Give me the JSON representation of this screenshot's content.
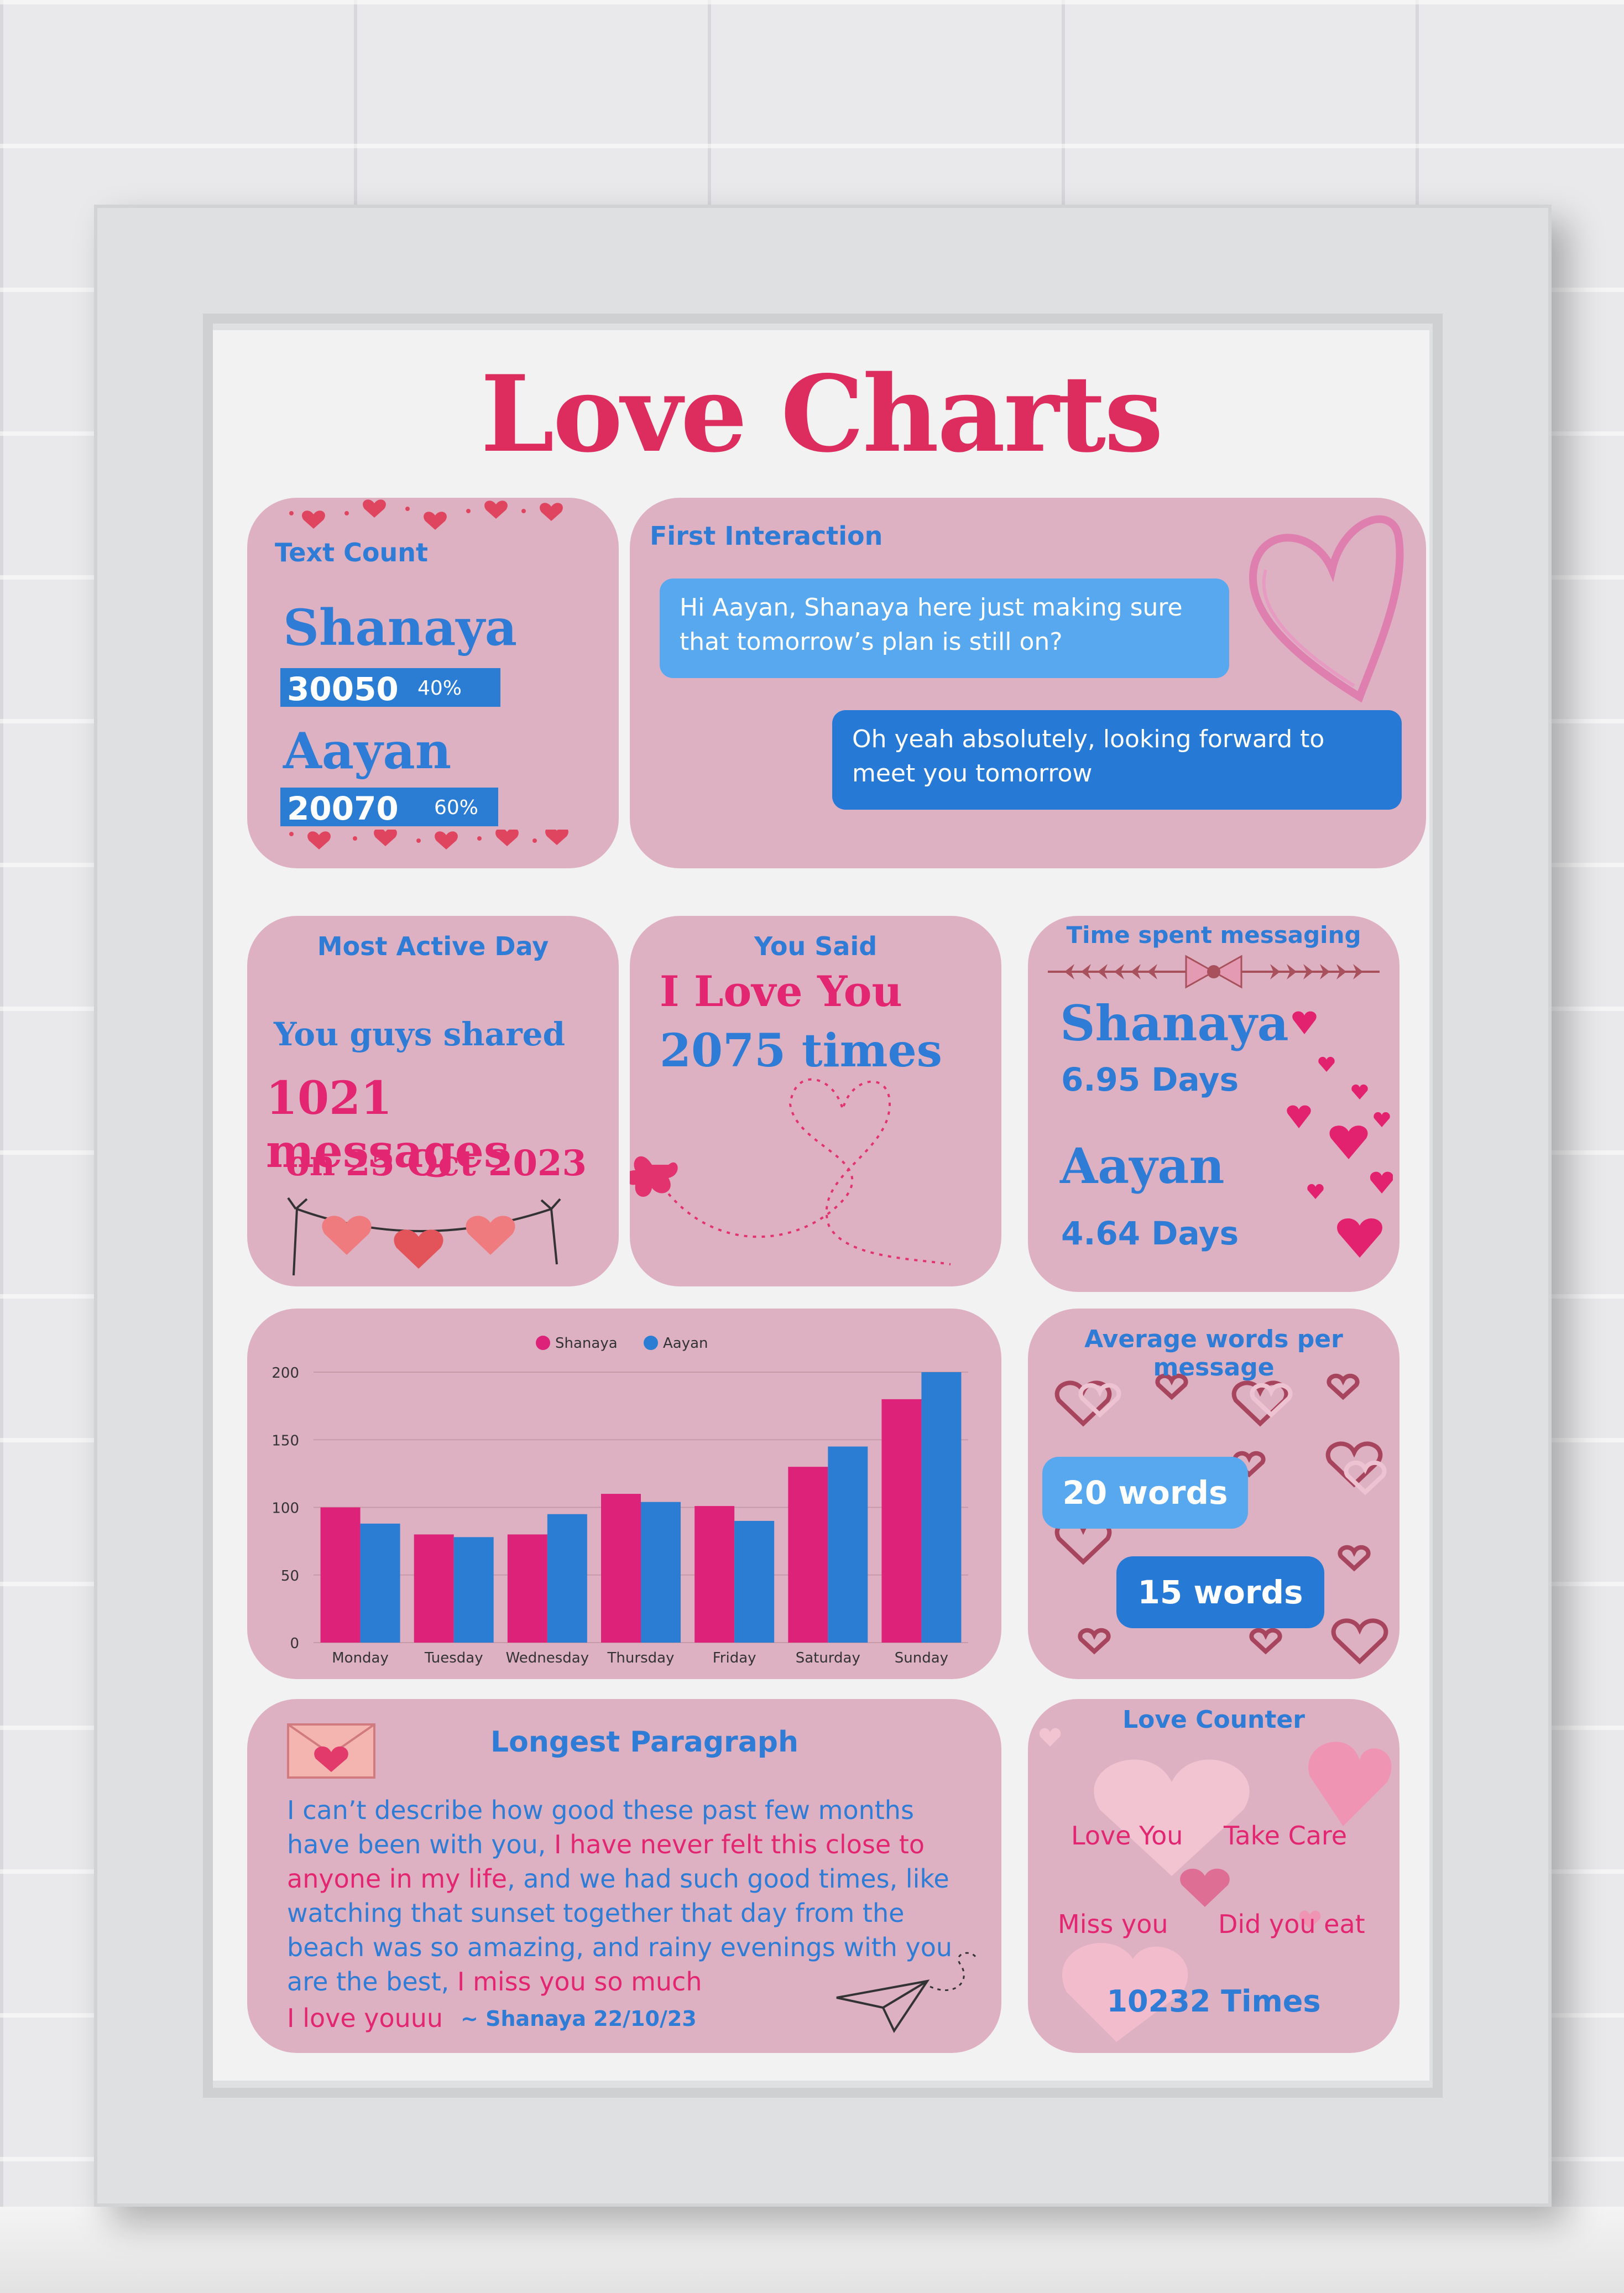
{
  "title": "Love Charts",
  "text_count": {
    "label": "Text Count",
    "people": [
      {
        "name": "Shanaya",
        "count": "30050",
        "pct": "40%"
      },
      {
        "name": "Aayan",
        "count": "20070",
        "pct": "60%"
      }
    ]
  },
  "first_interaction": {
    "label": "First Interaction",
    "msg1": "Hi Aayan, Shanaya here just making sure that tomorrow’s plan is still on?",
    "msg2": "Oh yeah absolutely, looking forward to meet you tomorrow"
  },
  "most_active_day": {
    "label": "Most Active Day",
    "line1": "You guys shared",
    "line2": "1021 messages",
    "on": "on",
    "date": "25 Oct 2023"
  },
  "you_said": {
    "label": "You Said",
    "phrase": "I Love You",
    "times": "2075 times"
  },
  "time_spent": {
    "label": "Time spent messaging",
    "people": [
      {
        "name": "Shanaya",
        "value": "6.95 Days"
      },
      {
        "name": "Aayan",
        "value": "4.64 Days"
      }
    ]
  },
  "avg_words": {
    "label": "Average words per message",
    "first": "20 words",
    "second": "15 words"
  },
  "longest_paragraph": {
    "label": "Longest Paragraph",
    "p1": "I can’t describe how good these past few months have been with you, ",
    "p2": "I have never felt this close to anyone in my life",
    "p3": ", and we had such good times, like watching that sunset together that day from the beach was so amazing, and rainy evenings with you are the best, ",
    "p4": "I miss you so much",
    "p5": "I love youuu",
    "signature": "~ Shanaya 22/10/23"
  },
  "love_counter": {
    "label": "Love Counter",
    "words": [
      "Love You",
      "Take Care",
      "Miss you",
      "Did you eat"
    ],
    "total": "10232 Times"
  },
  "colors": {
    "accent_pink": "#dd2c5e",
    "card": "#ddb1c2",
    "blue": "#2e7cd6",
    "light_blue": "#57a8ee",
    "magenta": "#e32671"
  },
  "chart_data": {
    "type": "bar",
    "categories": [
      "Monday",
      "Tuesday",
      "Wednesday",
      "Thursday",
      "Friday",
      "Saturday",
      "Sunday"
    ],
    "series": [
      {
        "name": "Shanaya",
        "color": "#dc2379",
        "values": [
          100,
          80,
          80,
          110,
          101,
          130,
          180
        ]
      },
      {
        "name": "Aayan",
        "color": "#2b7dd4",
        "values": [
          88,
          78,
          95,
          104,
          90,
          145,
          200
        ]
      }
    ],
    "yticks": [
      "0",
      "50",
      "100",
      "150",
      "200"
    ],
    "ylim": [
      0,
      200
    ],
    "grid": true,
    "legend": "top-center"
  }
}
